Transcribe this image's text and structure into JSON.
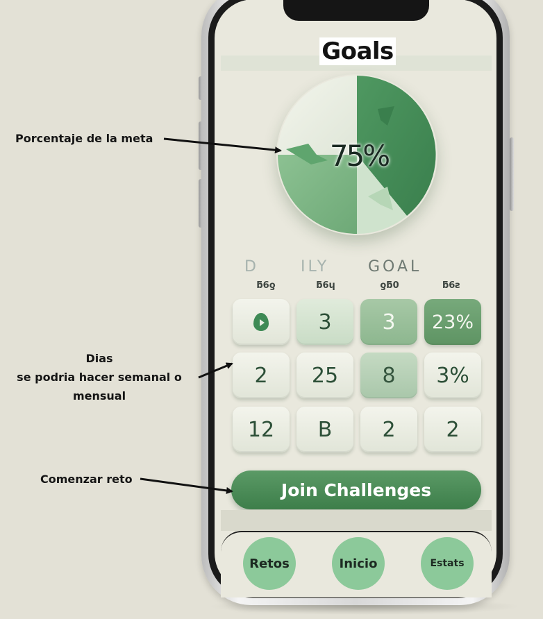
{
  "screen": {
    "title": "Goals",
    "progress": {
      "percent_label": "75%",
      "percent_value": 75
    },
    "table": {
      "headers": [
        "D",
        "ILY",
        "GOAL"
      ],
      "column_labels": [
        "ƃ6ƍ",
        "ƃ6ɥ",
        "ƍƃ0",
        "ƃ6ƨ"
      ],
      "rows": [
        [
          "",
          "3",
          "3",
          "23%"
        ],
        [
          "2",
          "25",
          "8",
          "3%"
        ],
        [
          "12",
          "B",
          "2",
          "2"
        ]
      ]
    },
    "join_button": "Join Challenges"
  },
  "tabbar": {
    "items": [
      "Retos",
      "Inicio",
      "Estats"
    ]
  },
  "annotations": {
    "porcentaje": "Porcentaje de la meta",
    "dias_line1": "Dias",
    "dias_line2": "se podria hacer semanal o",
    "dias_line3": "mensual",
    "comenzar": "Comenzar reto"
  },
  "colors": {
    "background": "#e3e1d6",
    "accent_green": "#3d7e4a",
    "tab_green": "#8cc99a",
    "donut_dark": "#3f8a55",
    "donut_light": "#eef1e6"
  }
}
